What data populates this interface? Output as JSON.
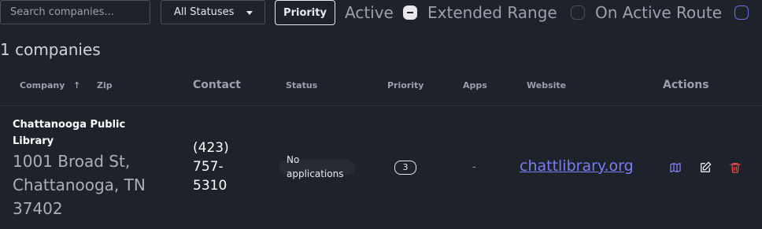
{
  "toolbar": {
    "search_placeholder": "Search companies...",
    "status_select": "All Statuses",
    "priority_button": "Priority",
    "filters": [
      {
        "label": "Active",
        "state": "indeterminate"
      },
      {
        "label": "Extended Range",
        "state": "unchecked"
      },
      {
        "label": "On Active Route",
        "state": "unchecked"
      }
    ]
  },
  "summary": {
    "count_text": "1 companies"
  },
  "table": {
    "headers": {
      "company": "Company",
      "sort_indicator": "↑",
      "zip": "Zip",
      "contact": "Contact",
      "status": "Status",
      "priority": "Priority",
      "apps": "Apps",
      "website": "Website",
      "actions": "Actions"
    },
    "rows": [
      {
        "name": "Chattanooga Public Library",
        "address": "1001 Broad St, Chattanooga, TN 37402",
        "phone": "(423) 757-5310",
        "status": "No applications",
        "priority": "3",
        "apps": "-",
        "website": "chattlibrary.org",
        "actions": [
          "map-icon",
          "edit-icon",
          "trash-icon"
        ]
      }
    ]
  },
  "colors": {
    "accent": "#7b7ef2",
    "danger": "#e5484d",
    "background": "#1e222b"
  }
}
